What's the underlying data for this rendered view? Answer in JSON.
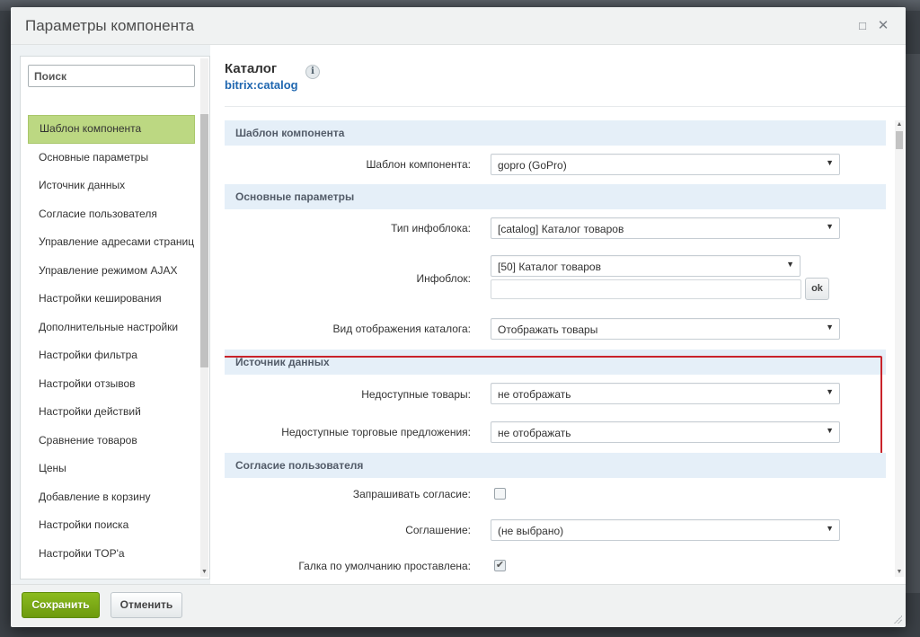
{
  "dialog": {
    "title": "Параметры компонента",
    "maximize_icon": "□",
    "close_icon": "✕"
  },
  "sidebar": {
    "search_placeholder": "Поиск",
    "items": [
      {
        "label": "Шаблон компонента",
        "active": true
      },
      {
        "label": "Основные параметры"
      },
      {
        "label": "Источник данных"
      },
      {
        "label": "Согласие пользователя"
      },
      {
        "label": "Управление адресами страниц"
      },
      {
        "label": "Управление режимом AJAX"
      },
      {
        "label": "Настройки кеширования"
      },
      {
        "label": "Дополнительные настройки"
      },
      {
        "label": "Настройки фильтра"
      },
      {
        "label": "Настройки отзывов"
      },
      {
        "label": "Настройки действий"
      },
      {
        "label": "Сравнение товаров"
      },
      {
        "label": "Цены"
      },
      {
        "label": "Добавление в корзину"
      },
      {
        "label": "Настройки поиска"
      },
      {
        "label": "Настройки TOP'а"
      }
    ]
  },
  "component": {
    "title": "Каталог",
    "code": "bitrix:catalog",
    "info_icon": "i"
  },
  "sections": {
    "template": {
      "heading": "Шаблон компонента",
      "template_label": "Шаблон компонента:",
      "template_value": "gopro (GoPro)"
    },
    "main": {
      "heading": "Основные параметры",
      "iblock_type_label": "Тип инфоблока:",
      "iblock_type_value": "[catalog] Каталог товаров",
      "iblock_label": "Инфоблок:",
      "iblock_value": "[50] Каталог товаров",
      "iblock_input_value": "",
      "ok_label": "ok",
      "view_mode_label": "Вид отображения каталога:",
      "view_mode_value": "Отображать товары"
    },
    "data_source": {
      "heading": "Источник данных",
      "unavailable_label": "Недоступные товары:",
      "unavailable_value": "не отображать",
      "offers_label": "Недоступные торговые предложения:",
      "offers_value": "не отображать"
    },
    "consent": {
      "heading": "Согласие пользователя",
      "ask_label": "Запрашивать согласие:",
      "ask_checked": false,
      "agreement_label": "Соглашение:",
      "agreement_value": "(не выбрано)",
      "default_label": "Галка по умолчанию проставлена:",
      "default_checked": true
    }
  },
  "footer": {
    "save_label": "Сохранить",
    "cancel_label": "Отменить"
  },
  "colors": {
    "accent_green": "#7aa918",
    "active_item": "#bcd882",
    "section_bg": "#e5eff8",
    "highlight_red": "#c9232a",
    "link_blue": "#2067b0"
  }
}
